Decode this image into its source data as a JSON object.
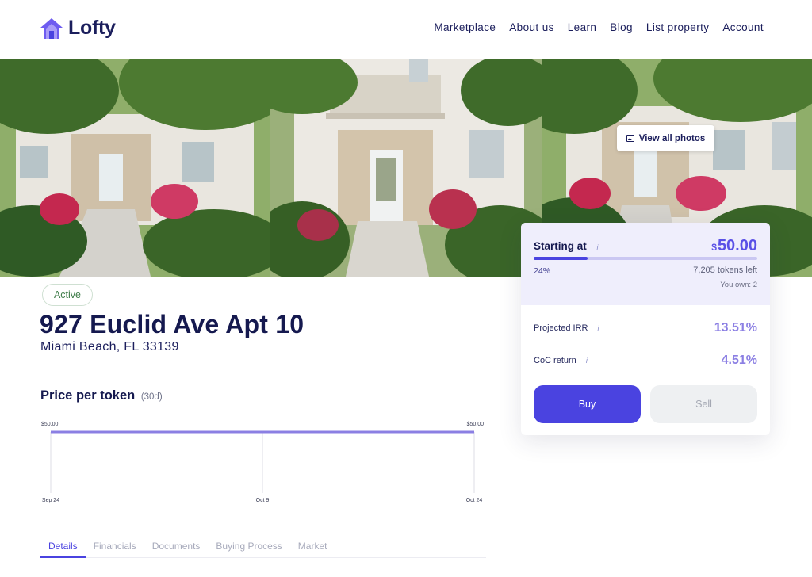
{
  "brand": {
    "name": "Lofty",
    "accent": "#4a43e0",
    "logo_icon": "house-logo-icon"
  },
  "nav": {
    "items": [
      "Marketplace",
      "About us",
      "Learn",
      "Blog",
      "List property",
      "Account"
    ]
  },
  "hero": {
    "view_photos_label": "View all photos",
    "view_photos_icon": "image-icon"
  },
  "property": {
    "status": "Active",
    "title": "927 Euclid Ave Apt 10",
    "address": "Miami Beach, FL 33139"
  },
  "price_chart": {
    "title": "Price per token",
    "period": "(30d)"
  },
  "chart_data": {
    "type": "line",
    "title": "Price per token",
    "x": [
      "Sep 24",
      "Oct 9",
      "Oct 24"
    ],
    "series": [
      {
        "values": [
          50.0,
          50.0,
          50.0
        ]
      }
    ],
    "start_label": "$50.00",
    "end_label": "$50.00",
    "grid": true,
    "color": "#8b7fe3"
  },
  "tabs": [
    "Details",
    "Financials",
    "Documents",
    "Buying Process",
    "Market"
  ],
  "purchase": {
    "starting_label": "Starting at",
    "currency_symbol": "$",
    "price": "50.00",
    "progress_percent": 24,
    "progress_label": "24%",
    "tokens_left": "7,205 tokens left",
    "you_own": "You own: 2",
    "info_glyph": "i",
    "irr_label": "Projected IRR",
    "irr_value": "13.51%",
    "coc_label": "CoC return",
    "coc_value": "4.51%",
    "buy_label": "Buy",
    "sell_label": "Sell"
  }
}
